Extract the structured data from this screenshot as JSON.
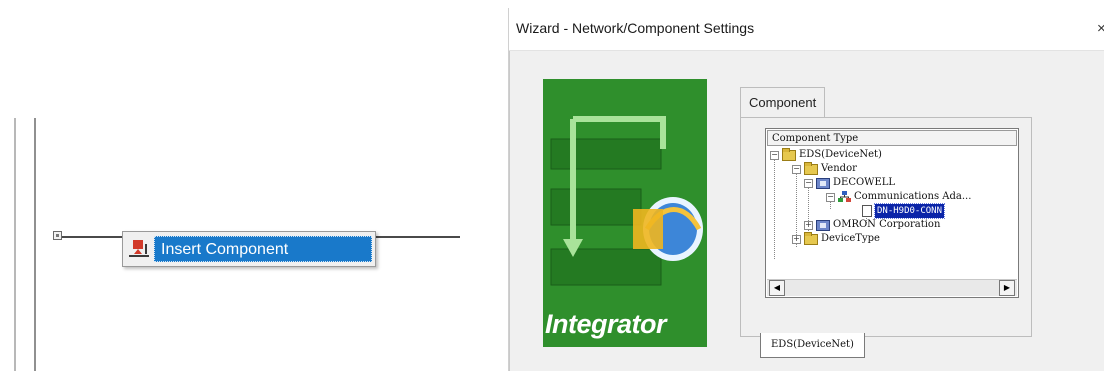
{
  "left_pane": {
    "context_menu": {
      "insert_label": "Insert Component",
      "insert_icon": "insert-component-icon"
    }
  },
  "dialog": {
    "title": "Wizard - Network/Component Settings",
    "close_glyph": "×",
    "splash": {
      "title": "Integrator",
      "accent": "#2d8a29"
    },
    "tab_label": "Component",
    "tree": {
      "header": "Component Type",
      "root": "EDS(DeviceNet)",
      "vendor_folder": "Vendor",
      "vendor_1": "DECOWELL",
      "category": "Communications Ada...",
      "selected_item": "DN-H9D0-CONN",
      "vendor_2": "OMRON Corporation",
      "device_type": "DeviceType"
    },
    "bottom_tab_label": "EDS(DeviceNet)",
    "selection_color": "#0a24a8",
    "menu_highlight_color": "#1979ca"
  }
}
